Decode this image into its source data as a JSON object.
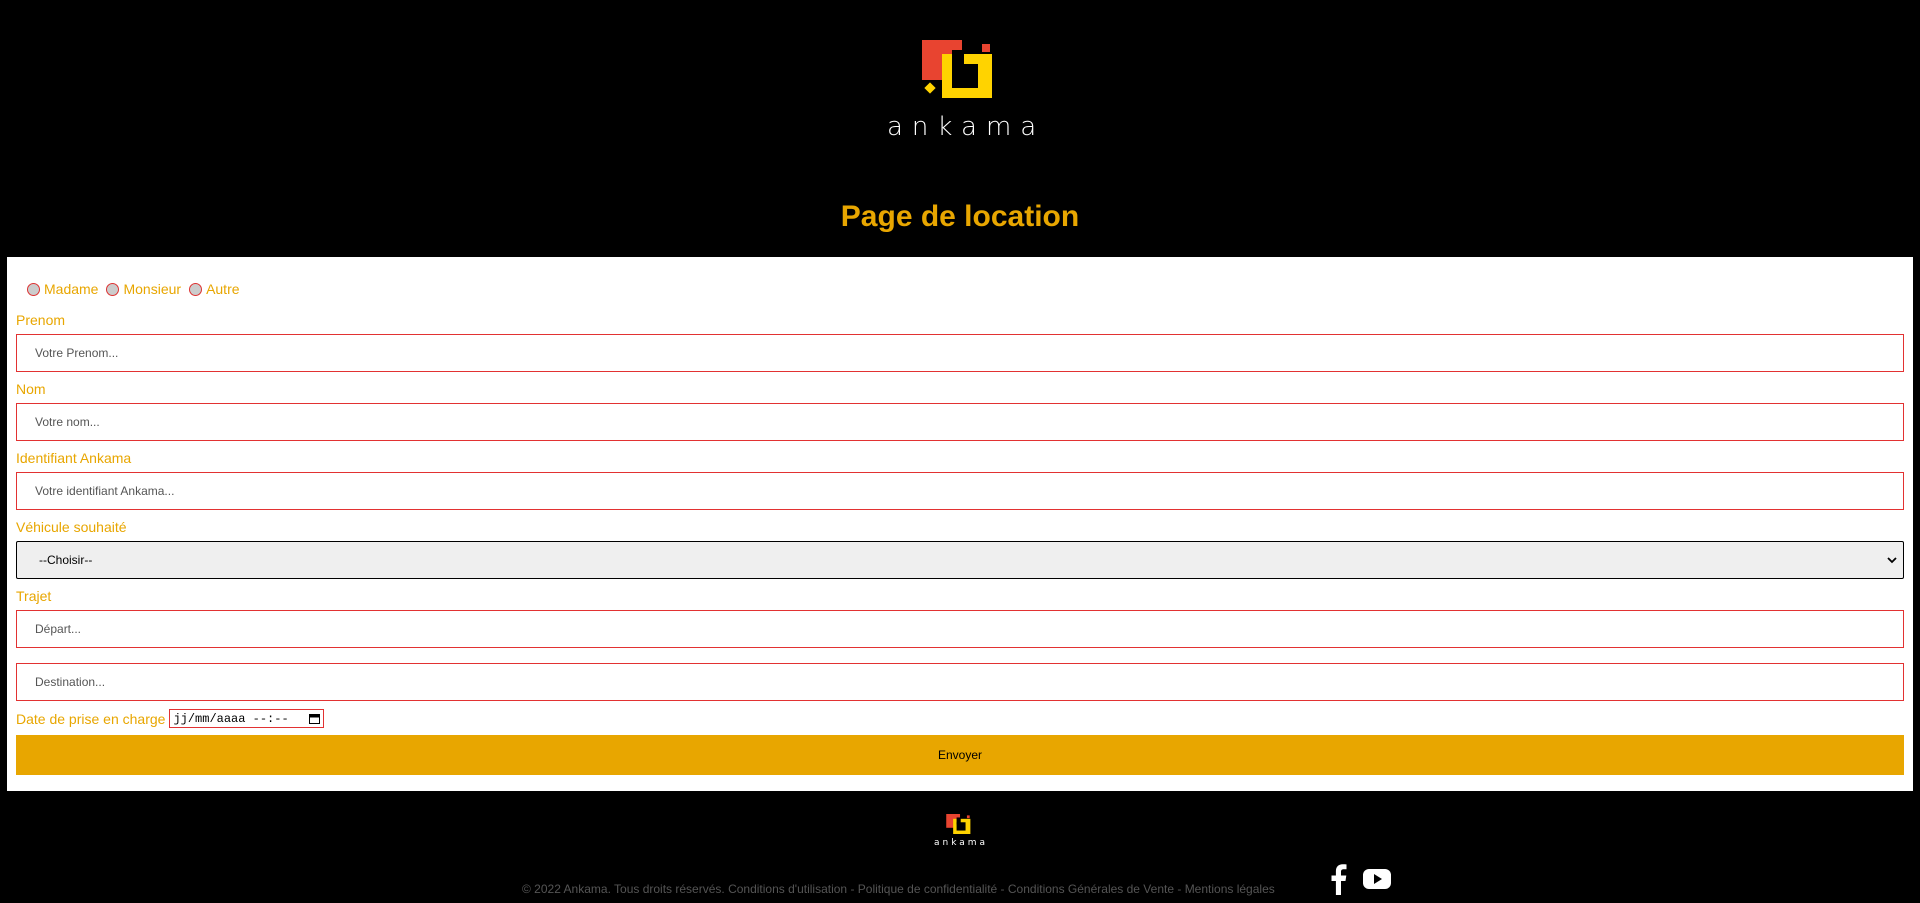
{
  "brand": {
    "name": "ankama",
    "colors": {
      "red": "#e84430",
      "yellow": "#ffd300",
      "accent": "#e8a600"
    }
  },
  "page": {
    "title": "Page de location"
  },
  "form": {
    "civility": [
      "Madame",
      "Monsieur",
      "Autre"
    ],
    "prenom": {
      "label": "Prenom",
      "placeholder": "Votre Prenom..."
    },
    "nom": {
      "label": "Nom",
      "placeholder": "Votre nom..."
    },
    "identifiant": {
      "label": "Identifiant Ankama",
      "placeholder": "Votre identifiant Ankama..."
    },
    "vehicule": {
      "label": "Véhicule souhaité",
      "selected": "--Choisir--"
    },
    "trajet": {
      "label": "Trajet",
      "depart_placeholder": "Départ...",
      "destination_placeholder": "Destination..."
    },
    "date": {
      "label": "Date de prise en charge",
      "placeholder": "jj/mm/aaaa --:--"
    },
    "submit_label": "Envoyer"
  },
  "footer": {
    "copyright": "© 2022 Ankama. Tous droits réservés.",
    "links": [
      "Conditions d'utilisation",
      "Politique de confidentialité",
      "Conditions Générales de Vente",
      "Mentions légales"
    ],
    "separator": " - ",
    "social_icons": [
      "facebook-icon",
      "youtube-icon"
    ]
  }
}
